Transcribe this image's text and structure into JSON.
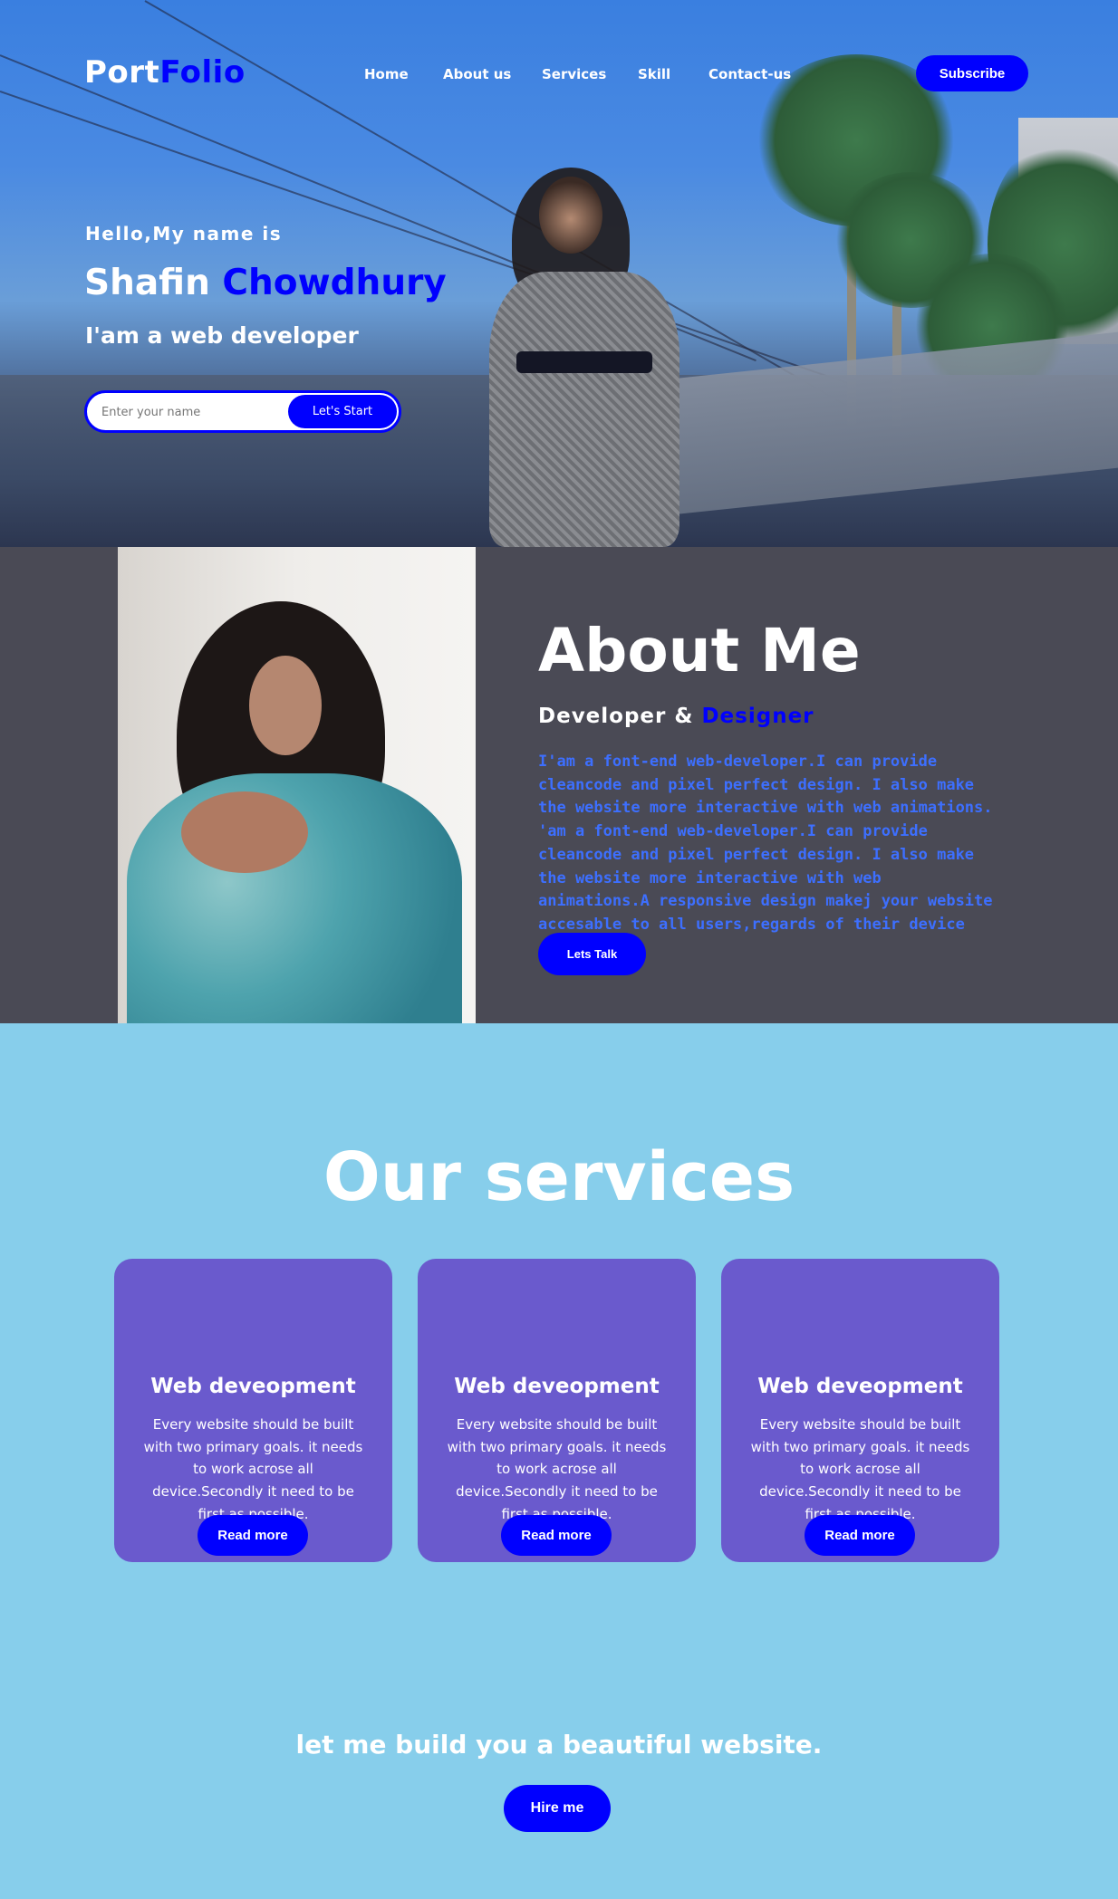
{
  "nav": {
    "logo_part1": "Port",
    "logo_part2": "Folio",
    "links": [
      {
        "label": "Home"
      },
      {
        "label": "About us"
      },
      {
        "label": "Services"
      },
      {
        "label": "Skill"
      },
      {
        "label": "Contact-us"
      }
    ],
    "subscribe_label": "Subscribe"
  },
  "hero": {
    "greeting": "Hello,My name is",
    "first_name": "Shafin",
    "last_name": "Chowdhury",
    "role": "I'am a web developer",
    "input_placeholder": "Enter your name",
    "start_label": "Let's Start"
  },
  "about": {
    "title": "About Me",
    "subtitle_part1": "Developer &",
    "subtitle_part2": "Designer",
    "text": "I'am a font-end web-developer.I can provide cleancode and pixel perfect design. I also make the website more interactive with web animations. 'am a font-end web-developer.I can provide cleancode and pixel perfect design. I also make the website more interactive with web animations.A responsive design makej your website accesable to all users,regards of their device",
    "button_label": "Lets Talk"
  },
  "services": {
    "title": "Our services",
    "cards": [
      {
        "title": "Web deveopment",
        "text": "Every website should be built with two primary goals. it needs to work acrose all device.Secondly it need to be first as possible.",
        "button": "Read more"
      },
      {
        "title": "Web deveopment",
        "text": "Every website should be built with two primary goals. it needs to work acrose all device.Secondly it need to be first as possible.",
        "button": "Read more"
      },
      {
        "title": "Web deveopment",
        "text": "Every website should be built with two primary goals. it needs to work acrose all device.Secondly it need to be first as possible.",
        "button": "Read more"
      }
    ],
    "cta_text": "let me build you a beautiful website.",
    "hire_label": "Hire me"
  },
  "colors": {
    "accent": "#0000ff",
    "about_bg": "#4a4a55",
    "services_bg": "#87ceeb",
    "card_bg": "#6a5acd",
    "about_text": "#3d6fff"
  }
}
